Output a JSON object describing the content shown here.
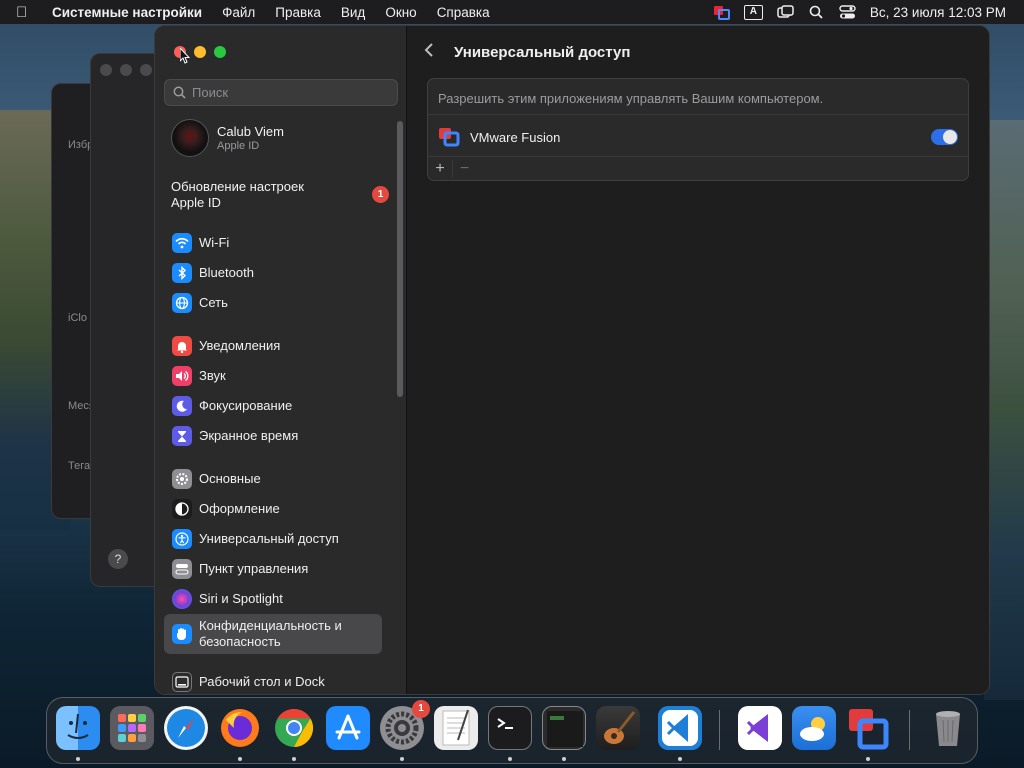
{
  "menubar": {
    "apple_icon": "apple-logo-icon",
    "app_name": "Системные настройки",
    "menus": [
      "Файл",
      "Правка",
      "Вид",
      "Окно",
      "Справка"
    ],
    "input_indicator": "A",
    "datetime": "Вс, 23 июля  12:03 PM"
  },
  "background_window": {
    "labels": [
      "Избр",
      "iClo",
      "Меся",
      "Тега"
    ]
  },
  "sidebar": {
    "search_placeholder": "Поиск",
    "account": {
      "name": "Calub Viem",
      "subtitle": "Apple ID"
    },
    "update": {
      "label": "Обновление настроек Apple ID",
      "badge": "1"
    },
    "items": [
      {
        "label": "Wi-Fi",
        "icon": "wifi-icon",
        "color": "#1a8cff"
      },
      {
        "label": "Bluetooth",
        "icon": "bluetooth-icon",
        "color": "#1a8cff"
      },
      {
        "label": "Сеть",
        "icon": "globe-icon",
        "color": "#1a8cff"
      },
      {
        "label": "Уведомления",
        "icon": "bell-icon",
        "color": "#ef4b42"
      },
      {
        "label": "Звук",
        "icon": "speaker-icon",
        "color": "#ee3f68"
      },
      {
        "label": "Фокусирование",
        "icon": "moon-icon",
        "color": "#5e5ce6"
      },
      {
        "label": "Экранное время",
        "icon": "hourglass-icon",
        "color": "#5e5ce6"
      },
      {
        "label": "Основные",
        "icon": "gear-icon",
        "color": "#8e8e93"
      },
      {
        "label": "Оформление",
        "icon": "appearance-icon",
        "color": "#1c1c1e"
      },
      {
        "label": "Универсальный доступ",
        "icon": "accessibility-icon",
        "color": "#1a8cff"
      },
      {
        "label": "Пункт управления",
        "icon": "control-center-icon",
        "color": "#8e8e93"
      },
      {
        "label": "Siri и Spotlight",
        "icon": "siri-icon",
        "color": "#7a3ed6"
      },
      {
        "label": "Конфиденциальность и безопасность",
        "icon": "hand-icon",
        "color": "#1a8cff"
      },
      {
        "label": "Рабочий стол и Dock",
        "icon": "dock-icon",
        "color": "#2c2c2e"
      }
    ]
  },
  "content": {
    "title": "Универсальный доступ",
    "description": "Разрешить этим приложениям управлять Вашим компьютером.",
    "apps": [
      {
        "name": "VMware Fusion",
        "enabled": true
      }
    ],
    "add_label": "+",
    "remove_label": "−"
  },
  "dock": {
    "items": [
      {
        "name": "finder",
        "color": "#2d8cf0"
      },
      {
        "name": "launchpad",
        "color": "#8a8a8e"
      },
      {
        "name": "safari",
        "color": "#1e88e5"
      },
      {
        "name": "firefox",
        "color": "#ff7a1a"
      },
      {
        "name": "chrome",
        "color": "#34a853"
      },
      {
        "name": "app-store",
        "color": "#1f8bff"
      },
      {
        "name": "system-settings",
        "color": "#8e8e93",
        "badge": "1"
      },
      {
        "name": "textedit",
        "color": "#e8e8e8"
      },
      {
        "name": "terminal",
        "color": "#1c1c1e"
      },
      {
        "name": "console",
        "color": "#2b2b2b"
      },
      {
        "name": "garageband",
        "color": "#6b4a2f"
      },
      {
        "name": "vscode",
        "color": "#1f7fd6"
      },
      {
        "name": "visual-studio",
        "color": "#ffffff"
      },
      {
        "name": "weather",
        "color": "#2f8df0"
      },
      {
        "name": "vmware-fusion",
        "color": "#1e6fd0"
      },
      {
        "name": "trash",
        "color": "#7a7a7e"
      }
    ]
  }
}
